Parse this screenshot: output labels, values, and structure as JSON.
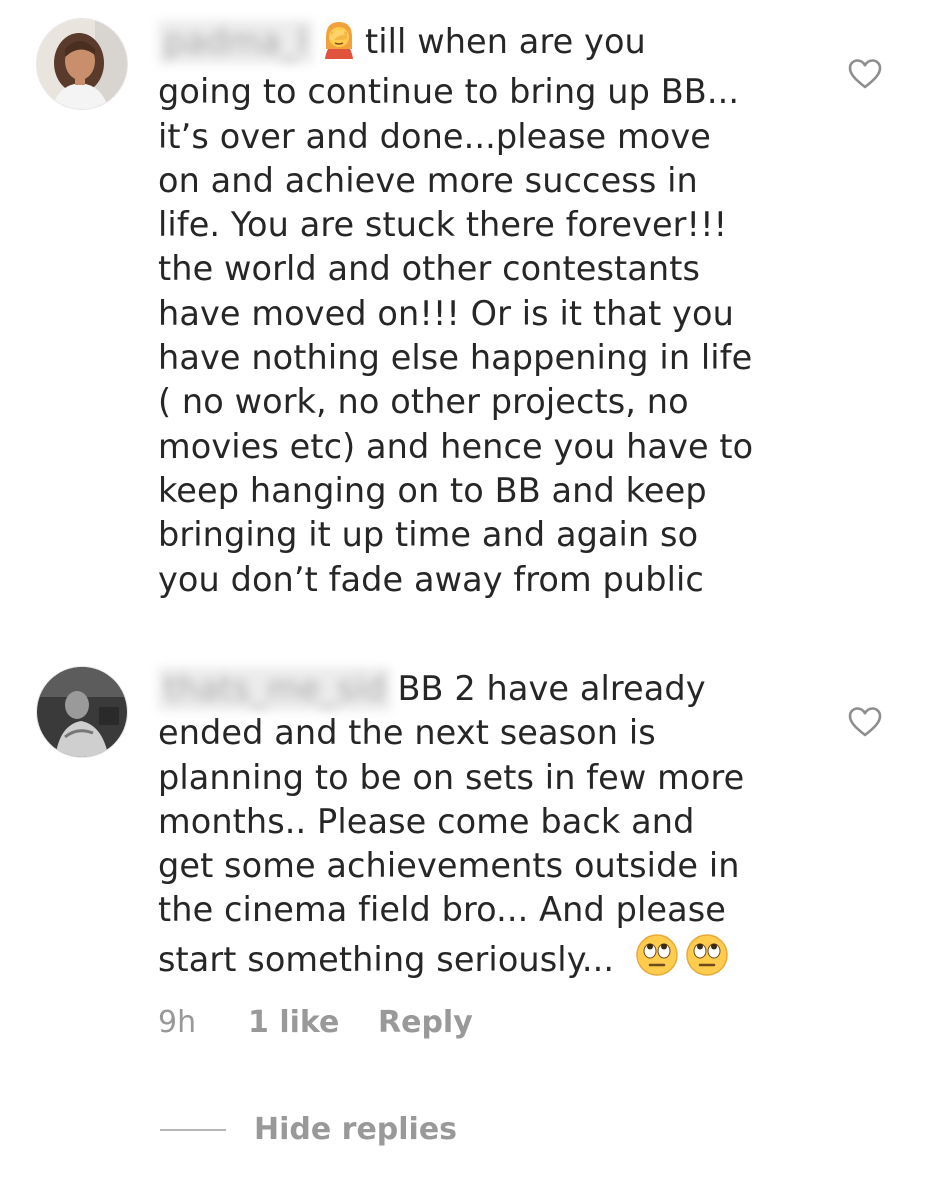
{
  "comments": [
    {
      "username": "padma_l",
      "lead_emoji": "woman-facepalming-emoji",
      "lines": [
        "till when are you",
        "going to continue to bring up BB...",
        "it’s over and done...please move",
        "on and achieve more success in",
        "life. You are stuck there forever!!!",
        "the world and other contestants",
        "have moved on!!! Or is it that you",
        "have nothing else happening in life",
        "( no work, no other projects, no",
        "movies etc) and hence you have to",
        "keep hanging on to BB and keep",
        "bringing it up time and again so",
        "you don’t fade away from public"
      ],
      "like_icon": "heart-outline-icon"
    },
    {
      "username": "thats_me_sid",
      "lines": [
        "BB 2 have already",
        "ended and the next season is",
        "planning to be on sets in few more",
        "months.. Please come back and",
        "get some achievements outside in",
        "the cinema field bro... And please",
        "start something seriously..."
      ],
      "trailing_emojis": [
        "face-with-rolling-eyes-emoji",
        "face-with-rolling-eyes-emoji"
      ],
      "like_icon": "heart-outline-icon",
      "meta": {
        "time": "9h",
        "likes": "1 like",
        "reply": "Reply"
      }
    }
  ],
  "thread": {
    "hide_replies": "Hide replies"
  }
}
